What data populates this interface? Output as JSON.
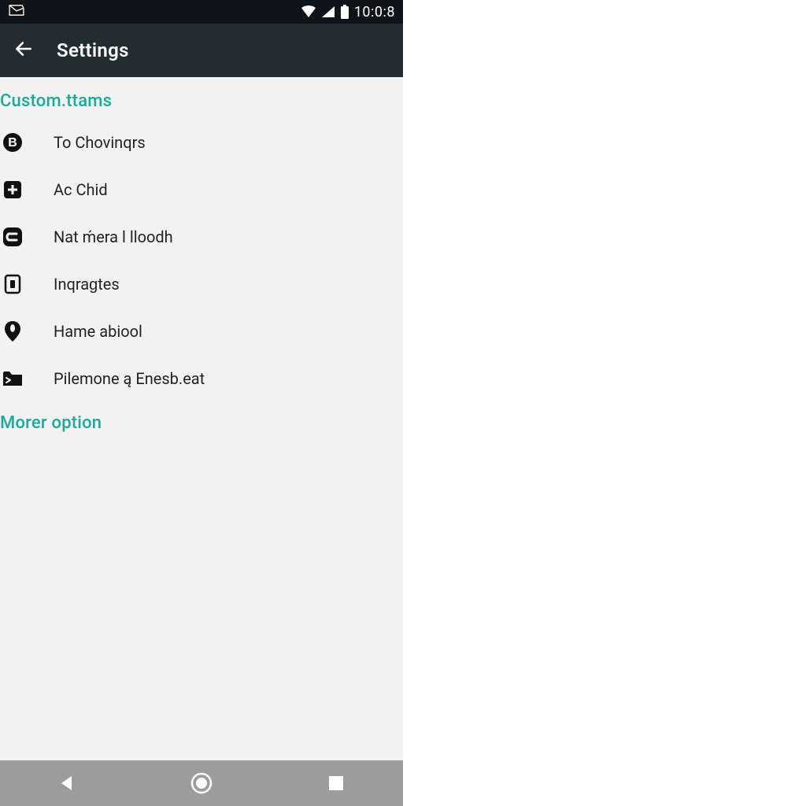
{
  "status_bar": {
    "clock": "10:0:8"
  },
  "app_bar": {
    "title": "Settings"
  },
  "sections": [
    {
      "title": "Custom.ttams",
      "items": [
        {
          "icon": "b-circle-icon",
          "label": "To Chovinqrs"
        },
        {
          "icon": "plus-square-icon",
          "label": "Ac Chid"
        },
        {
          "icon": "rounded-e-icon",
          "label": "Nat ḿera l lloodh"
        },
        {
          "icon": "page-icon",
          "label": "Inqraɡtes"
        },
        {
          "icon": "pin-icon",
          "label": "Hame abiool"
        },
        {
          "icon": "terminal-folder-icon",
          "label": "Pilemone ą Enesb.eat"
        }
      ]
    },
    {
      "title": "Morer option",
      "items": []
    }
  ],
  "colors": {
    "accent": "#1aa99a",
    "app_bar_bg": "#232c31",
    "status_bar_bg": "#0e1418",
    "content_bg": "#f2f2f2",
    "nav_bar_bg": "#9c9c9c"
  }
}
